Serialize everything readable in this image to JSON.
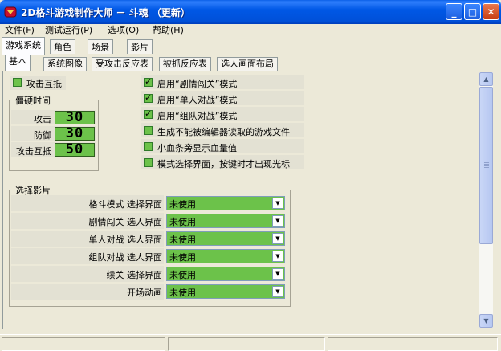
{
  "window": {
    "title": "2D格斗游戏制作大师 － 斗魂 （更新）",
    "minimize_glyph": "_",
    "maximize_glyph": "□",
    "close_glyph": "✕"
  },
  "menu": [
    "文件(F)",
    "测试运行(P)",
    "选项(O)",
    "帮助(H)"
  ],
  "top_tabs": [
    "游戏系统",
    "角色",
    "场景",
    "影片"
  ],
  "sub_tabs": [
    "基本",
    "系统图像",
    "受攻击反应表",
    "被抓反应表",
    "选人画面布局"
  ],
  "attack_clash": {
    "label": "攻击互抵",
    "checked": false
  },
  "stiffness_group": {
    "title": "僵硬时间",
    "rows": [
      {
        "label": "攻击",
        "value": "30"
      },
      {
        "label": "防御",
        "value": "30"
      },
      {
        "label": "攻击互抵",
        "value": "50"
      }
    ]
  },
  "options": [
    {
      "label": "启用“剧情闯关”模式",
      "checked": true
    },
    {
      "label": "启用“单人对战”模式",
      "checked": true
    },
    {
      "label": "启用“组队对战”模式",
      "checked": true
    },
    {
      "label": "生成不能被编辑器读取的游戏文件",
      "checked": false
    },
    {
      "label": "小血条旁显示血量值",
      "checked": false
    },
    {
      "label": "模式选择界面，按键时才出现光标",
      "checked": false
    }
  ],
  "movie_group": {
    "title": "选择影片",
    "rows": [
      {
        "label": "格斗模式 选择界面",
        "value": "未使用"
      },
      {
        "label": "剧情闯关 选人界面",
        "value": "未使用"
      },
      {
        "label": "单人对战 选人界面",
        "value": "未使用"
      },
      {
        "label": "组队对战 选人界面",
        "value": "未使用"
      },
      {
        "label": "续关 选择界面",
        "value": "未使用"
      },
      {
        "label": "开场动画",
        "value": "未使用"
      }
    ]
  },
  "colors": {
    "accent_green": "#6cc24a",
    "titlebar_blue": "#0058e6"
  }
}
